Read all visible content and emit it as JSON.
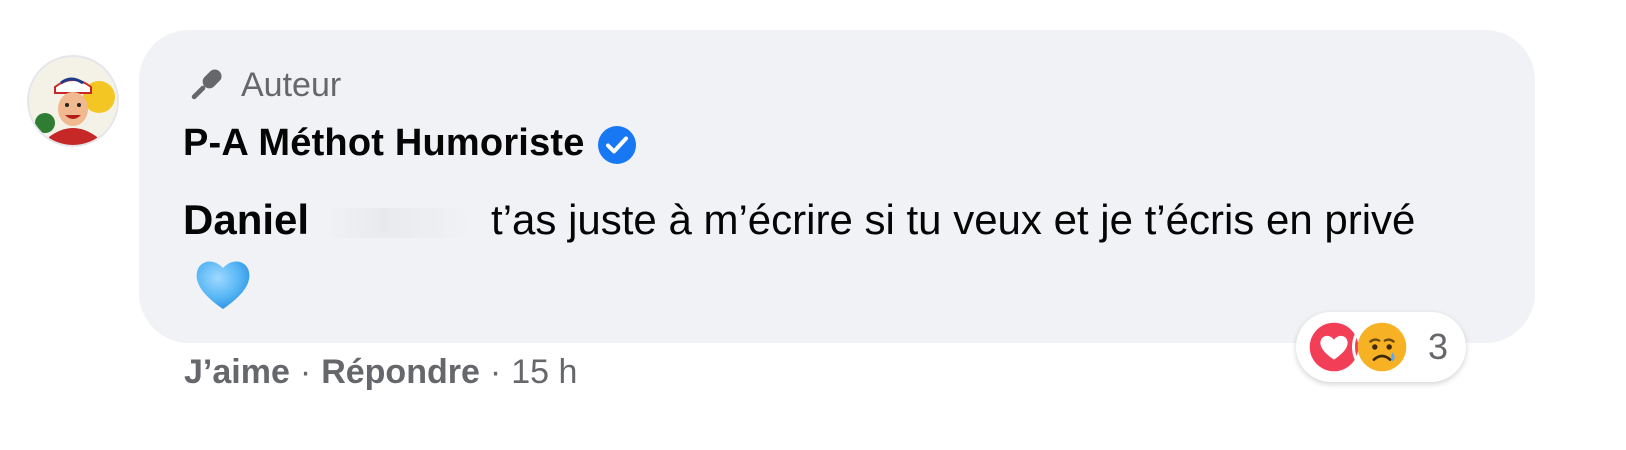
{
  "comment": {
    "author_badge": "Auteur",
    "commenter_name": "P-A Méthot Humoriste",
    "mention": "Daniel",
    "text": "t’as juste à m’écrire si tu veux et je t’écris en privé",
    "icons": {
      "badge": "microphone-icon",
      "verified": "verified-badge-icon",
      "emoji": "blue-heart-emoji"
    }
  },
  "actions": {
    "like_label": "J’aime",
    "separator": "·",
    "reply_label": "Répondre",
    "timestamp": "15 h"
  },
  "reactions": {
    "types": [
      "love",
      "sad"
    ],
    "count": "3"
  },
  "colors": {
    "bubble": "#f0f2f5",
    "secondary_text": "#65676b",
    "verified_blue": "#1877f2",
    "love_red": "#f33e58",
    "sad_yellow": "#f7b125"
  }
}
